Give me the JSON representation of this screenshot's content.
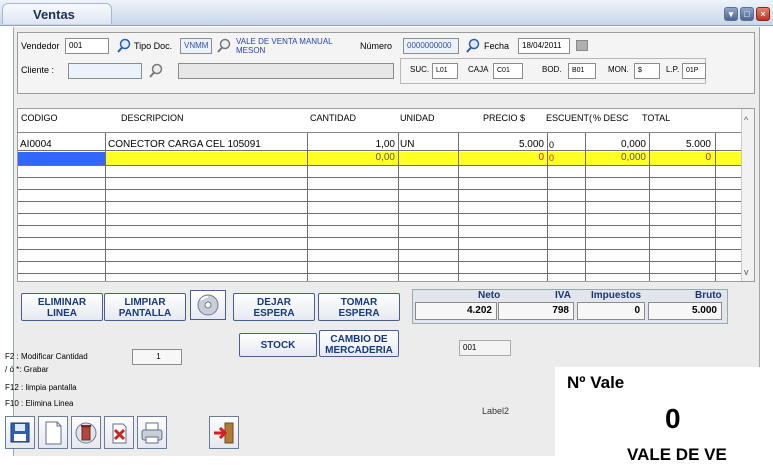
{
  "window": {
    "title": "Ventas"
  },
  "header": {
    "vendedor_label": "Vendedor",
    "vendedor_value": "001",
    "tipo_doc_label": "Tipo Doc.",
    "tipo_doc_value": "VNMM",
    "tipo_doc_desc": "VALE DE VENTA MANUAL MESON",
    "numero_label": "Número",
    "numero_value": "0000000000",
    "fecha_label": "Fecha",
    "fecha_value": "18/04/2011",
    "cliente_label": "Cliente :",
    "cliente_value": "",
    "cliente_name": "",
    "suc_label": "SUC.",
    "suc_value": "L01",
    "caja_label": "CAJA",
    "caja_value": "C01",
    "bod_label": "BOD.",
    "bod_value": "B01",
    "mon_label": "MON.",
    "mon_value": "$",
    "lp_label": "L.P.",
    "lp_value": "01P"
  },
  "grid": {
    "columns": [
      "CODIGO",
      "DESCRIPCION",
      "CANTIDAD",
      "UNIDAD",
      "PRECIO $",
      "ESCUENT(",
      "% DESC",
      "TOTAL"
    ],
    "rows": [
      {
        "codigo": "AI0004",
        "descripcion": "CONECTOR CARGA CEL 105091",
        "cantidad": "1,00",
        "unidad": "UN",
        "precio": "5.000",
        "descuento": "0",
        "pdesc": "0,000",
        "total": "5.000"
      },
      {
        "codigo": "",
        "descripcion": "",
        "cantidad": "0,00",
        "unidad": "",
        "precio": "0",
        "descuento": "0",
        "pdesc": "0,000",
        "total": "0"
      }
    ]
  },
  "buttons": {
    "eliminar": "ELIMINAR\nLINEA",
    "limpiar": "LIMPIAR\nPANTALLA",
    "dejar": "DEJAR\nESPERA",
    "tomar": "TOMAR\nESPERA",
    "stock": "STOCK",
    "cambio": "CAMBIO DE\nMERCADERIA"
  },
  "totals": {
    "neto_label": "Neto",
    "neto": "4.202",
    "iva_label": "IVA",
    "iva": "798",
    "impuestos_label": "Impuestos",
    "impuestos": "0",
    "bruto_label": "Bruto",
    "bruto": "5.000"
  },
  "help": {
    "f2": "F2 : Modificar Cantidad",
    "f2_value": "1",
    "grabar": "/ ó *: Grabar",
    "f12": "F12 : limpia pantalla",
    "f10": "F10 : Elimina Linea"
  },
  "misc": {
    "code_field": "001",
    "label2": "Label2"
  },
  "vale": {
    "title": "Nº Vale",
    "number": "0",
    "partial": "VALE DE VE"
  },
  "colors": {
    "highlight_row": "#ffff22",
    "selected_cell": "#3366ff",
    "button_text": "#163a7a"
  },
  "toolbar": [
    "save-icon",
    "new-document-icon",
    "trash-icon",
    "cancel-icon",
    "printer-icon",
    "exit-icon"
  ]
}
